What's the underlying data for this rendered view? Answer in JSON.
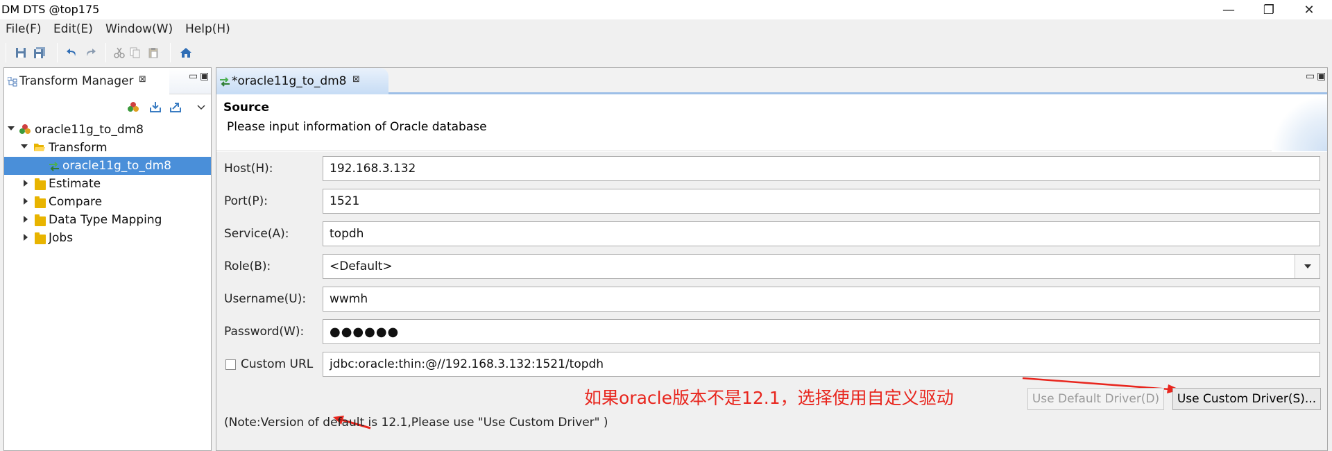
{
  "window": {
    "title": "DM DTS @top175",
    "controls": {
      "minimize": "—",
      "restore": "❐",
      "close": "✕"
    }
  },
  "menu": [
    "File(F)",
    "Edit(E)",
    "Window(W)",
    "Help(H)"
  ],
  "toolbar": {
    "icons": [
      "save-icon",
      "save-all-icon",
      "undo-icon",
      "redo-icon",
      "cut-icon",
      "copy-icon",
      "paste-icon",
      "home-icon"
    ]
  },
  "left_view": {
    "tab_label": "Transform Manager",
    "tree": [
      {
        "label": "oracle11g_to_dm8",
        "depth": 0,
        "expanded": true
      },
      {
        "label": "Transform",
        "depth": 1,
        "expanded": true
      },
      {
        "label": "oracle11g_to_dm8",
        "depth": 2,
        "selected": true
      },
      {
        "label": "Estimate",
        "depth": 1,
        "expanded": false
      },
      {
        "label": "Compare",
        "depth": 1,
        "expanded": false
      },
      {
        "label": "Data Type Mapping",
        "depth": 1,
        "expanded": false
      },
      {
        "label": "Jobs",
        "depth": 1,
        "expanded": false
      }
    ]
  },
  "editor": {
    "tab_label": "*oracle11g_to_dm8",
    "header_title": "Source",
    "header_subtitle": "Please input information of Oracle database",
    "fields": {
      "host": {
        "label": "Host(H):",
        "value": "192.168.3.132"
      },
      "port": {
        "label": "Port(P):",
        "value": "1521"
      },
      "service": {
        "label": "Service(A):",
        "value": "topdh"
      },
      "role": {
        "label": "Role(B):",
        "value": "<Default>"
      },
      "username": {
        "label": "Username(U):",
        "value": "wwmh"
      },
      "password": {
        "label": "Password(W):",
        "value": "●●●●●●"
      },
      "custom_url": {
        "label": "Custom URL",
        "value": "jdbc:oracle:thin:@//192.168.3.132:1521/topdh",
        "checked": false
      }
    },
    "buttons": {
      "default_driver": "Use Default Driver(D)",
      "custom_driver": "Use Custom Driver(S)..."
    },
    "note": "(Note:Version of default is 12.1,Please use \"Use Custom Driver\" )",
    "annotation": "如果oracle版本不是12.1，选择使用自定义驱动",
    "annotation_color": "#e8261e"
  },
  "colors": {
    "selection": "#4a8fd9",
    "active_tab": "#c6dcf5"
  }
}
